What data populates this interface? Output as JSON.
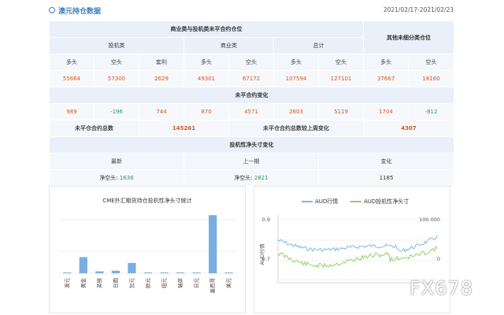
{
  "header": {
    "title": "澳元持仓数据",
    "date_range": "2021/02/17-2021/02/23"
  },
  "table": {
    "group_commercial_speculative": "商业类与投机类未平合约仓位",
    "group_other": "其他未细分类仓位",
    "speculative": "投机类",
    "commercial": "商业类",
    "total": "总计",
    "long": "多头",
    "short": "空头",
    "arbitrage": "套利",
    "positions": {
      "spec_long": "55664",
      "spec_short": "57300",
      "spec_arb": "2629",
      "comm_long": "49301",
      "comm_short": "67172",
      "total_long": "107594",
      "total_short": "127101",
      "other_long": "37667",
      "other_short": "18160"
    },
    "change_title": "未平合约变化",
    "changes": {
      "spec_long": "989",
      "spec_short": "-196",
      "spec_arb": "744",
      "comm_long": "870",
      "comm_short": "4571",
      "total_long": "2603",
      "total_short": "5119",
      "other_long": "1704",
      "other_short": "-812"
    },
    "oi_total_label": "未平仓合约总数",
    "oi_total_value": "145261",
    "oi_change_label": "未平仓合约总数较上周变化",
    "oi_change_value": "4307",
    "net_change_title": "投机性净头寸变化",
    "latest_label": "最新",
    "previous_label": "上一期",
    "change_label": "变化",
    "net_short_label": "净空头:",
    "latest_value": "1636",
    "previous_value": "2821",
    "change_value": "1185"
  },
  "chart_data": [
    {
      "type": "bar",
      "title": "CME外汇期货持仓投机性净头寸统计",
      "categories": [
        "澳元",
        "黄金",
        "英镑",
        "日圆",
        "加元",
        "欧元",
        "纽元",
        "瑞郎",
        "日元",
        "墨西哥",
        "美元"
      ],
      "values": [
        1,
        25,
        3,
        4,
        16,
        0.5,
        0.5,
        0.5,
        0.5,
        90,
        0
      ],
      "color": "#7aaee2"
    },
    {
      "type": "line",
      "series": [
        {
          "name": "AUD行情",
          "color": "#7ab8e8"
        },
        {
          "name": "AUD投机性净头寸",
          "color": "#8fd16b"
        }
      ],
      "ylabel_left": "AUD行情",
      "left_ticks": [
        "0.9",
        "0.7"
      ],
      "right_ticks": [
        "100 000",
        "0"
      ]
    }
  ],
  "watermark": "FX678"
}
